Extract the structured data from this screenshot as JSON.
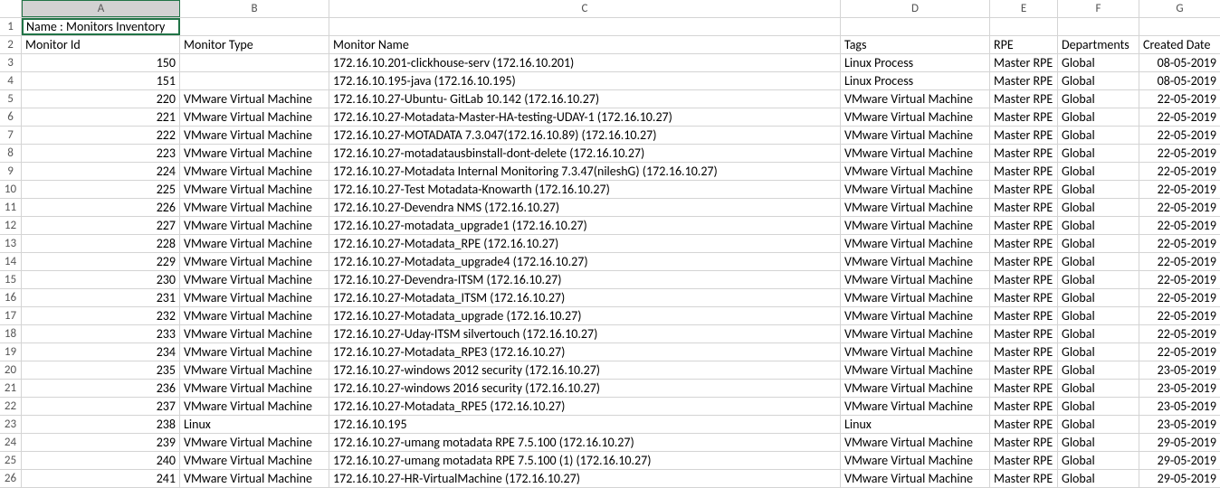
{
  "columns": [
    "A",
    "B",
    "C",
    "D",
    "E",
    "F",
    "G"
  ],
  "title_row": {
    "a": "Name : Monitors Inventory"
  },
  "headers": {
    "a": "Monitor Id",
    "b": "Monitor Type",
    "c": "Monitor Name",
    "d": "Tags",
    "e": "RPE",
    "f": "Departments",
    "g": "Created Date"
  },
  "rows": [
    {
      "id": "150",
      "type": "",
      "name": "172.16.10.201-clickhouse-serv (172.16.10.201)",
      "tags": "Linux Process",
      "rpe": "Master RPE",
      "dept": "Global",
      "date": "08-05-2019"
    },
    {
      "id": "151",
      "type": "",
      "name": "172.16.10.195-java (172.16.10.195)",
      "tags": "Linux Process",
      "rpe": "Master RPE",
      "dept": "Global",
      "date": "08-05-2019"
    },
    {
      "id": "220",
      "type": "VMware Virtual Machine",
      "name": "172.16.10.27-Ubuntu- GitLab 10.142 (172.16.10.27)",
      "tags": "VMware Virtual Machine",
      "rpe": "Master RPE",
      "dept": "Global",
      "date": "22-05-2019"
    },
    {
      "id": "221",
      "type": "VMware Virtual Machine",
      "name": "172.16.10.27-Motadata-Master-HA-testing-UDAY-1 (172.16.10.27)",
      "tags": "VMware Virtual Machine",
      "rpe": "Master RPE",
      "dept": "Global",
      "date": "22-05-2019"
    },
    {
      "id": "222",
      "type": "VMware Virtual Machine",
      "name": "172.16.10.27-MOTADATA 7.3.047(172.16.10.89) (172.16.10.27)",
      "tags": "VMware Virtual Machine",
      "rpe": "Master RPE",
      "dept": "Global",
      "date": "22-05-2019"
    },
    {
      "id": "223",
      "type": "VMware Virtual Machine",
      "name": "172.16.10.27-motadatausbinstall-dont-delete (172.16.10.27)",
      "tags": "VMware Virtual Machine",
      "rpe": "Master RPE",
      "dept": "Global",
      "date": "22-05-2019"
    },
    {
      "id": "224",
      "type": "VMware Virtual Machine",
      "name": "172.16.10.27-Motadata Internal Monitoring 7.3.47(nileshG) (172.16.10.27)",
      "tags": "VMware Virtual Machine",
      "rpe": "Master RPE",
      "dept": "Global",
      "date": "22-05-2019"
    },
    {
      "id": "225",
      "type": "VMware Virtual Machine",
      "name": "172.16.10.27-Test Motadata-Knowarth (172.16.10.27)",
      "tags": "VMware Virtual Machine",
      "rpe": "Master RPE",
      "dept": "Global",
      "date": "22-05-2019"
    },
    {
      "id": "226",
      "type": "VMware Virtual Machine",
      "name": "172.16.10.27-Devendra NMS (172.16.10.27)",
      "tags": "VMware Virtual Machine",
      "rpe": "Master RPE",
      "dept": "Global",
      "date": "22-05-2019"
    },
    {
      "id": "227",
      "type": "VMware Virtual Machine",
      "name": "172.16.10.27-motadata_upgrade1 (172.16.10.27)",
      "tags": "VMware Virtual Machine",
      "rpe": "Master RPE",
      "dept": "Global",
      "date": "22-05-2019"
    },
    {
      "id": "228",
      "type": "VMware Virtual Machine",
      "name": "172.16.10.27-Motadata_RPE (172.16.10.27)",
      "tags": "VMware Virtual Machine",
      "rpe": "Master RPE",
      "dept": "Global",
      "date": "22-05-2019"
    },
    {
      "id": "229",
      "type": "VMware Virtual Machine",
      "name": "172.16.10.27-Motadata_upgrade4 (172.16.10.27)",
      "tags": "VMware Virtual Machine",
      "rpe": "Master RPE",
      "dept": "Global",
      "date": "22-05-2019"
    },
    {
      "id": "230",
      "type": "VMware Virtual Machine",
      "name": "172.16.10.27-Devendra-ITSM (172.16.10.27)",
      "tags": "VMware Virtual Machine",
      "rpe": "Master RPE",
      "dept": "Global",
      "date": "22-05-2019"
    },
    {
      "id": "231",
      "type": "VMware Virtual Machine",
      "name": "172.16.10.27-Motadata_ITSM (172.16.10.27)",
      "tags": "VMware Virtual Machine",
      "rpe": "Master RPE",
      "dept": "Global",
      "date": "22-05-2019"
    },
    {
      "id": "232",
      "type": "VMware Virtual Machine",
      "name": "172.16.10.27-Motadata_upgrade (172.16.10.27)",
      "tags": "VMware Virtual Machine",
      "rpe": "Master RPE",
      "dept": "Global",
      "date": "22-05-2019"
    },
    {
      "id": "233",
      "type": "VMware Virtual Machine",
      "name": "172.16.10.27-Uday-ITSM silvertouch (172.16.10.27)",
      "tags": "VMware Virtual Machine",
      "rpe": "Master RPE",
      "dept": "Global",
      "date": "22-05-2019"
    },
    {
      "id": "234",
      "type": "VMware Virtual Machine",
      "name": "172.16.10.27-Motadata_RPE3 (172.16.10.27)",
      "tags": "VMware Virtual Machine",
      "rpe": "Master RPE",
      "dept": "Global",
      "date": "22-05-2019"
    },
    {
      "id": "235",
      "type": "VMware Virtual Machine",
      "name": "172.16.10.27-windows 2012 security (172.16.10.27)",
      "tags": "VMware Virtual Machine",
      "rpe": "Master RPE",
      "dept": "Global",
      "date": "23-05-2019"
    },
    {
      "id": "236",
      "type": "VMware Virtual Machine",
      "name": "172.16.10.27-windows 2016 security (172.16.10.27)",
      "tags": "VMware Virtual Machine",
      "rpe": "Master RPE",
      "dept": "Global",
      "date": "23-05-2019"
    },
    {
      "id": "237",
      "type": "VMware Virtual Machine",
      "name": "172.16.10.27-Motadata_RPE5 (172.16.10.27)",
      "tags": "VMware Virtual Machine",
      "rpe": "Master RPE",
      "dept": "Global",
      "date": "23-05-2019"
    },
    {
      "id": "238",
      "type": "Linux",
      "name": "172.16.10.195",
      "tags": "Linux",
      "rpe": "Master RPE",
      "dept": "Global",
      "date": "23-05-2019"
    },
    {
      "id": "239",
      "type": "VMware Virtual Machine",
      "name": "172.16.10.27-umang motadata RPE 7.5.100 (172.16.10.27)",
      "tags": "VMware Virtual Machine",
      "rpe": "Master RPE",
      "dept": "Global",
      "date": "29-05-2019"
    },
    {
      "id": "240",
      "type": "VMware Virtual Machine",
      "name": "172.16.10.27-umang motadata RPE 7.5.100 (1) (172.16.10.27)",
      "tags": "VMware Virtual Machine",
      "rpe": "Master RPE",
      "dept": "Global",
      "date": "29-05-2019"
    },
    {
      "id": "241",
      "type": "VMware Virtual Machine",
      "name": "172.16.10.27-HR-VirtualMachine (172.16.10.27)",
      "tags": "VMware Virtual Machine",
      "rpe": "Master RPE",
      "dept": "Global",
      "date": "29-05-2019"
    }
  ]
}
